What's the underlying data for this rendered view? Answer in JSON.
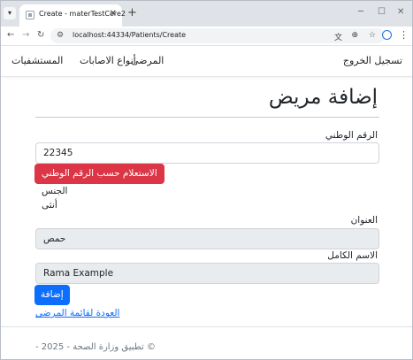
{
  "browser": {
    "tab_title": "Create - materTestCore2",
    "new_tab_symbol": "+",
    "url": "localhost:44334/Patients/Create"
  },
  "navbar": {
    "brand_links": [
      "المستشفيات",
      "أنواع الاصابات",
      "المرضى"
    ],
    "logout": "تسجيل الخروج"
  },
  "page": {
    "title": "إضافة مريض",
    "national_id_label": "الرقم الوطني",
    "national_id_value": "22345",
    "query_button": "الاستعلام حسب الرقم الوطني",
    "gender_label": "الجنس",
    "gender_value": "أنثى",
    "address_label": "العنوان",
    "address_value": "حمص",
    "fullname_label": "الاسم الكامل",
    "fullname_value": "Rama Example",
    "submit_button": "إضافة",
    "back_link": "العودة لقائمة المرضى"
  },
  "footer": {
    "text": "- تطبيق وزارة الصحة - 2025 ©"
  },
  "colors": {
    "danger": "#dc3545",
    "primary": "#0d6efd",
    "readonly_bg": "#e9ecef"
  }
}
